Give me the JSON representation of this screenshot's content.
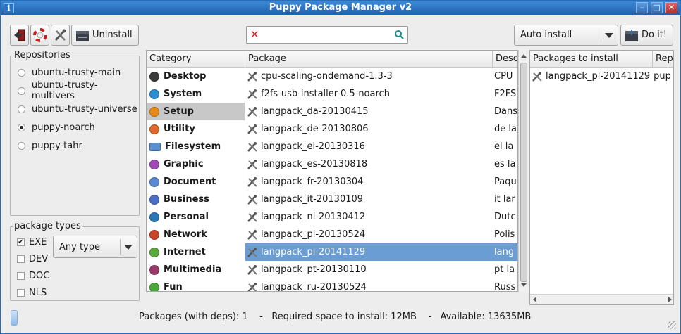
{
  "window": {
    "title": "Puppy Package Manager v2",
    "app_icon_letter": "i"
  },
  "toolbar": {
    "uninstall_label": "Uninstall",
    "search": {
      "value": "",
      "placeholder": ""
    },
    "install_mode": "Auto install",
    "do_it_label": "Do it!"
  },
  "repositories": {
    "legend": "Repositories",
    "items": [
      {
        "label": "ubuntu-trusty-main",
        "selected": false
      },
      {
        "label": "ubuntu-trusty-multivers",
        "selected": false
      },
      {
        "label": "ubuntu-trusty-universe",
        "selected": false
      },
      {
        "label": "puppy-noarch",
        "selected": true
      },
      {
        "label": "puppy-tahr",
        "selected": false
      }
    ]
  },
  "package_types": {
    "legend": "package types",
    "checks": [
      {
        "label": "EXE",
        "checked": true
      },
      {
        "label": "DEV",
        "checked": false
      },
      {
        "label": "DOC",
        "checked": false
      },
      {
        "label": "NLS",
        "checked": false
      }
    ],
    "type_select": "Any type"
  },
  "categories": {
    "header": "Category",
    "items": [
      {
        "label": "Desktop",
        "icon": "desktop-icon",
        "color": "#3a3a3a"
      },
      {
        "label": "System",
        "icon": "system-icon",
        "color": "#2c8fd1"
      },
      {
        "label": "Setup",
        "icon": "setup-icon",
        "color": "#e88a1a",
        "selected": true
      },
      {
        "label": "Utility",
        "icon": "utility-icon",
        "color": "#e0682a"
      },
      {
        "label": "Filesystem",
        "icon": "folder-icon",
        "color": "#5b8fcf"
      },
      {
        "label": "Graphic",
        "icon": "graphic-icon",
        "color": "#a04ab8"
      },
      {
        "label": "Document",
        "icon": "document-icon",
        "color": "#5a8ad6"
      },
      {
        "label": "Business",
        "icon": "business-icon",
        "color": "#4a6fc4"
      },
      {
        "label": "Personal",
        "icon": "personal-icon",
        "color": "#2a78b8"
      },
      {
        "label": "Network",
        "icon": "network-icon",
        "color": "#c8452a"
      },
      {
        "label": "Internet",
        "icon": "internet-icon",
        "color": "#5aa83a"
      },
      {
        "label": "Multimedia",
        "icon": "multimedia-icon",
        "color": "#9a3a6a"
      },
      {
        "label": "Fun",
        "icon": "fun-icon",
        "color": "#4aa83a"
      }
    ]
  },
  "packages": {
    "headers": {
      "package": "Package",
      "description": "Desc"
    },
    "rows": [
      {
        "name": "cpu-scaling-ondemand-1.3-3",
        "desc": "CPU"
      },
      {
        "name": "f2fs-usb-installer-0.5-noarch",
        "desc": "F2FS"
      },
      {
        "name": "langpack_da-20130415",
        "desc": "Dans"
      },
      {
        "name": "langpack_de-20130806",
        "desc": "de la"
      },
      {
        "name": "langpack_el-20130316",
        "desc": "el la"
      },
      {
        "name": "langpack_es-20130818",
        "desc": "es la"
      },
      {
        "name": "langpack_fr-20130304",
        "desc": "Paqu"
      },
      {
        "name": "langpack_it-20130109",
        "desc": "it lar"
      },
      {
        "name": "langpack_nl-20130412",
        "desc": "Dutc"
      },
      {
        "name": "langpack_pl-20130524",
        "desc": "Polis"
      },
      {
        "name": "langpack_pl-20141129",
        "desc": "lang",
        "selected": true
      },
      {
        "name": "langpack_pt-20130110",
        "desc": "pt la"
      },
      {
        "name": "langpack_ru-20130524",
        "desc": "Russ"
      }
    ]
  },
  "install_list": {
    "headers": {
      "package": "Packages to install",
      "repo": "Rep"
    },
    "rows": [
      {
        "name": "langpack_pl-20141129",
        "repo": "pup"
      }
    ]
  },
  "status": {
    "text": "Packages (with deps): 1    -   Required space to install: 12MB    -   Available: 13635MB"
  }
}
